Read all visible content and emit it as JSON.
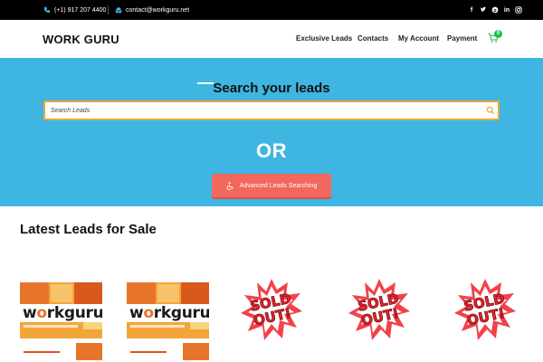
{
  "topbar": {
    "phone": "(+1) 917 207 4400",
    "email": "contact@workguru.net",
    "social": [
      "facebook-icon",
      "twitter-icon",
      "pinterest-icon",
      "linkedin-icon",
      "instagram-icon"
    ]
  },
  "header": {
    "logo": "WORK GURU",
    "nav": [
      "Exclusive Leads",
      "Contacts",
      "My Account",
      "Payment"
    ],
    "cart_count": "0"
  },
  "hero": {
    "title": "Search your leads",
    "search_placeholder": "Search Leads",
    "or_text": "OR",
    "advanced_button": "Advanced Leads Searching",
    "colors": {
      "background": "#3fb5e2",
      "button": "#f2685d",
      "search_border": "#e5a93a"
    }
  },
  "latest": {
    "title": "Latest Leads for Sale",
    "products": [
      {
        "kind": "workguru",
        "brand_left": "w",
        "brand_accent": "o",
        "brand_right": "rkguru"
      },
      {
        "kind": "workguru",
        "brand_left": "w",
        "brand_accent": "o",
        "brand_right": "rkguru"
      },
      {
        "kind": "sold-out",
        "stamp_line1": "SOLD",
        "stamp_line2": "OUT!"
      },
      {
        "kind": "sold-out",
        "stamp_line1": "SOLD",
        "stamp_line2": "OUT!"
      },
      {
        "kind": "sold-out",
        "stamp_line1": "SOLD",
        "stamp_line2": "OUT!"
      }
    ]
  }
}
